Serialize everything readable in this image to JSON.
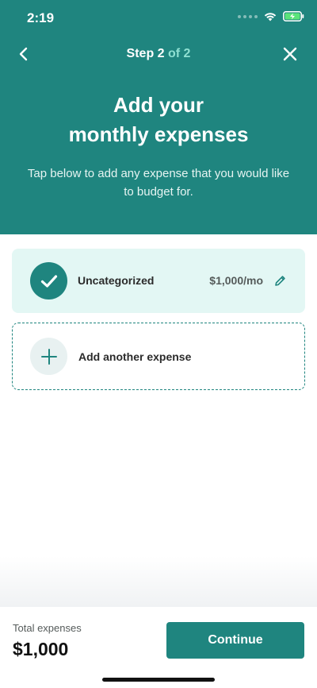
{
  "status_bar": {
    "time": "2:19"
  },
  "nav": {
    "step_prefix": "Step 2",
    "step_suffix": " of 2",
    "back_icon": "chevron-left-icon",
    "close_icon": "close-icon"
  },
  "header": {
    "title_line1": "Add your",
    "title_line2": "monthly expenses",
    "subtitle": "Tap below to add any expense that you would like to budget for."
  },
  "expenses": [
    {
      "name": "Uncategorized",
      "amount": "$1,000/mo",
      "icon": "checkmark-icon",
      "edit_icon": "pencil-icon"
    }
  ],
  "add_expense": {
    "label": "Add another expense",
    "icon": "plus-icon"
  },
  "footer": {
    "total_label": "Total expenses",
    "total_value": "$1,000",
    "continue_label": "Continue"
  },
  "colors": {
    "primary": "#1f857f",
    "accent_light": "#8fe0d2",
    "card_background": "#e3f7f4"
  }
}
